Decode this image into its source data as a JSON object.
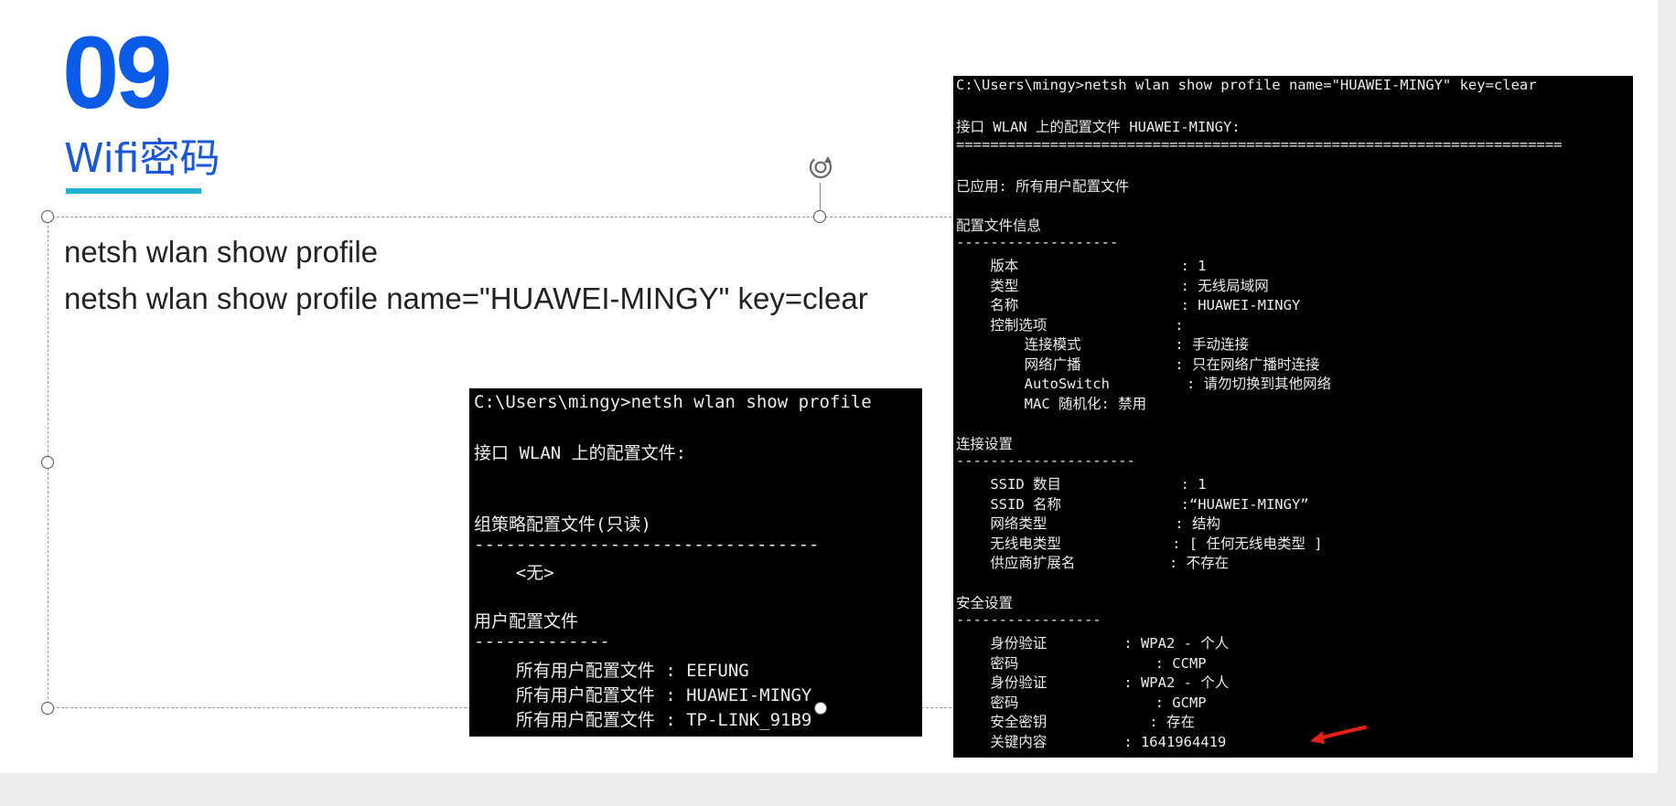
{
  "slide": {
    "number": "09",
    "title": "Wifi密码",
    "commands": [
      "netsh wlan show profile",
      "netsh wlan show profile name=\"HUAWEI-MINGY\" key=clear"
    ]
  },
  "terminal_profiles": {
    "prompt": "C:\\Users\\mingy>netsh wlan show profile",
    "interface_header": "接口 WLAN 上的配置文件:",
    "group_policy_header": "组策略配置文件(只读)",
    "group_policy_rule": "---------------------------------",
    "group_policy_none": "    <无>",
    "user_profiles_header": "用户配置文件",
    "user_profiles_rule": "-------------",
    "user_profiles": [
      "    所有用户配置文件 : EEFUNG",
      "    所有用户配置文件 : HUAWEI-MINGY",
      "    所有用户配置文件 : TP-LINK_91B9"
    ]
  },
  "terminal_detail": {
    "prompt": "C:\\Users\\mingy>netsh wlan show profile name=\"HUAWEI-MINGY\" key=clear",
    "interface_header": "接口 WLAN 上的配置文件 HUAWEI-MINGY:",
    "double_rule": "=======================================================================",
    "applied": "已应用: 所有用户配置文件",
    "profile_info_header": "配置文件信息",
    "profile_info_rule": "-------------------",
    "profile_info": [
      "    版本                   : 1",
      "    类型                   : 无线局域网",
      "    名称                   : HUAWEI-MINGY",
      "    控制选项               :",
      "        连接模式           : 手动连接",
      "        网络广播           : 只在网络广播时连接",
      "        AutoSwitch         : 请勿切换到其他网络",
      "        MAC 随机化: 禁用"
    ],
    "connection_header": "连接设置",
    "connection_rule": "---------------------",
    "connection": [
      "    SSID 数目              : 1",
      "    SSID 名称              :“HUAWEI-MINGY”",
      "    网络类型               : 结构",
      "    无线电类型             : [ 任何无线电类型 ]",
      "    供应商扩展名           : 不存在"
    ],
    "security_header": "安全设置",
    "security_rule": "-----------------",
    "security": [
      "    身份验证         : WPA2 - 个人",
      "    密码                : CCMP",
      "    身份验证         : WPA2 - 个人",
      "    密码                : GCMP",
      "    安全密钥            : 存在",
      "    关键内容         : 1641964419"
    ]
  },
  "colors": {
    "accent_blue": "#0a5be8",
    "underline_cyan": "#1fb2d2",
    "terminal_bg": "#000000",
    "arrow_red": "#e8201c"
  }
}
